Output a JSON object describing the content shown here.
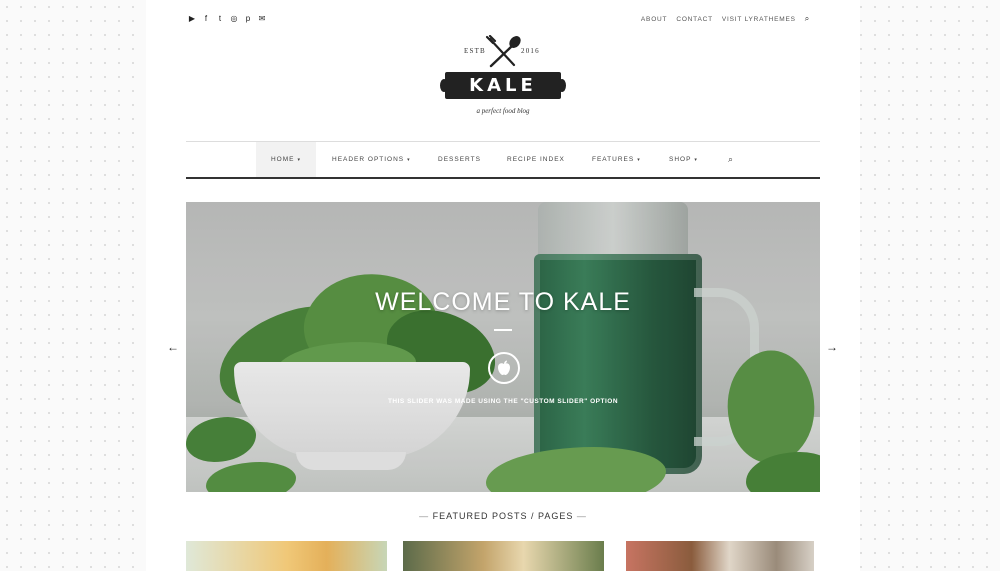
{
  "social": {
    "icons": [
      "youtube-icon",
      "facebook-icon",
      "twitter-icon",
      "instagram-icon",
      "pinterest-icon",
      "email-icon"
    ],
    "glyphs": [
      "▶",
      "f",
      "t",
      "◎",
      "p",
      "✉"
    ]
  },
  "toplinks": {
    "items": [
      "ABOUT",
      "CONTACT",
      "VISIT LYRATHEMES"
    ],
    "search_glyph": "⌕"
  },
  "logo": {
    "estb": "ESTB",
    "year": "2016",
    "name": "KALE",
    "tagline": "a perfect food blog"
  },
  "nav": {
    "items": [
      {
        "label": "HOME",
        "caret": "▾"
      },
      {
        "label": "HEADER OPTIONS",
        "caret": "▾"
      },
      {
        "label": "DESSERTS",
        "caret": ""
      },
      {
        "label": "RECIPE INDEX",
        "caret": ""
      },
      {
        "label": "FEATURES",
        "caret": "▾"
      },
      {
        "label": "SHOP",
        "caret": "▾"
      }
    ],
    "search_glyph": "⌕"
  },
  "slider": {
    "title": "WELCOME TO KALE",
    "subtitle": "THIS SLIDER WAS MADE USING THE \"CUSTOM SLIDER\" OPTION",
    "icon_glyph": "",
    "prev_glyph": "←",
    "next_glyph": "→"
  },
  "featured": {
    "dash_left": "—",
    "title": "FEATURED POSTS / PAGES",
    "dash_right": "—"
  }
}
